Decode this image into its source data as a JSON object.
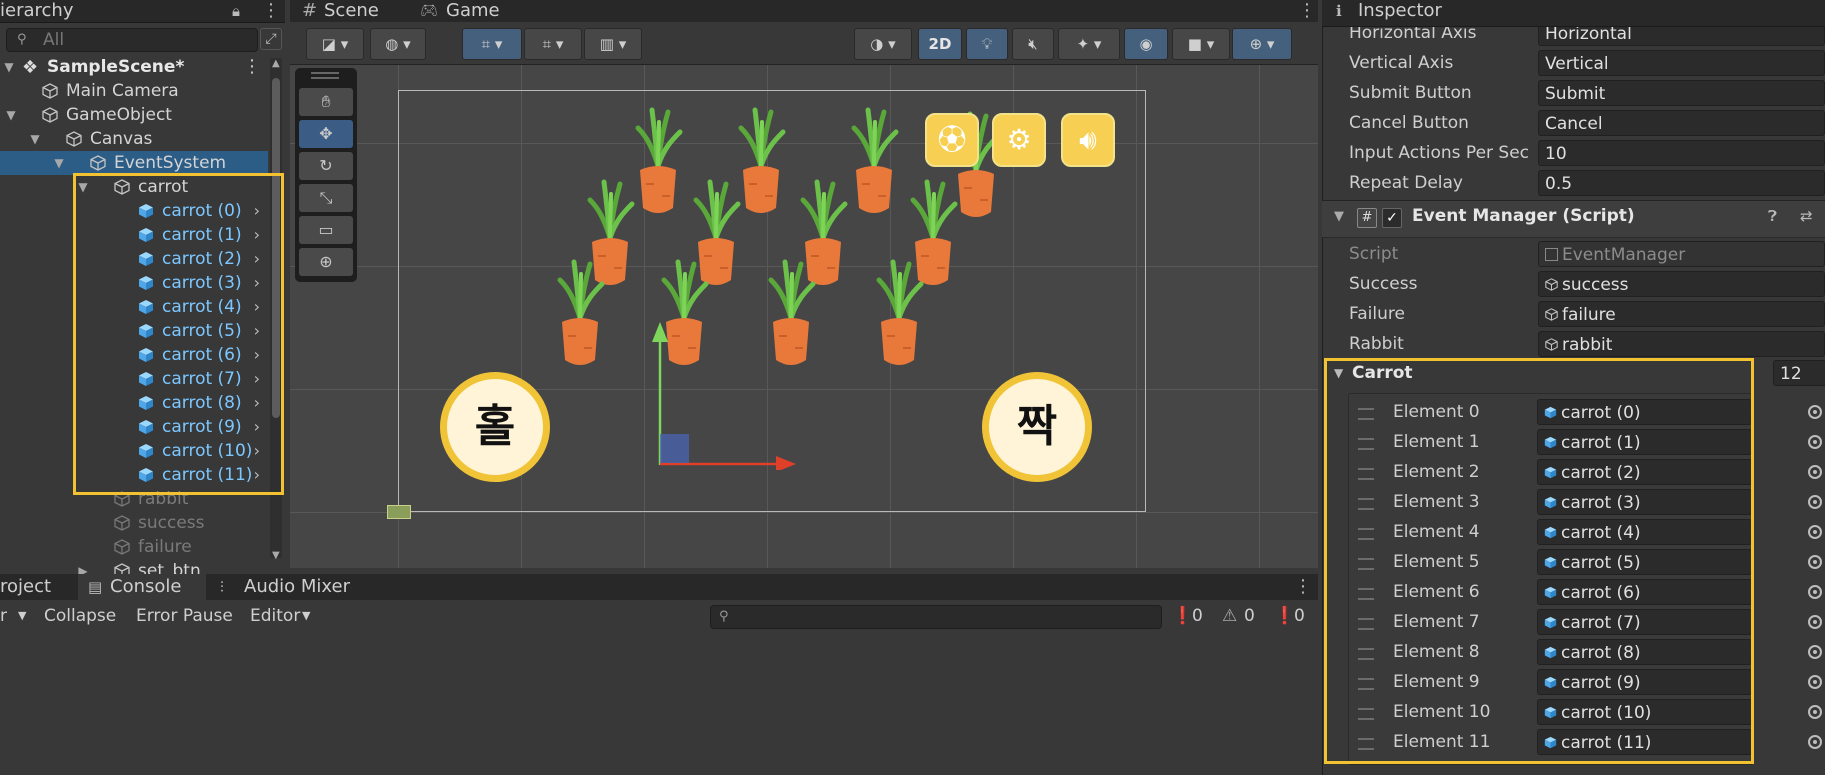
{
  "colors": {
    "highlight": "#f2c230",
    "selection": "#2c5d87",
    "prefab_blue": "#7cc7ff"
  },
  "hierarchy": {
    "tab": "ierarchy",
    "search_placeholder": "All",
    "scene_name": "SampleScene*",
    "items": [
      {
        "label": "Main Camera",
        "style": "normal"
      },
      {
        "label": "GameObject",
        "style": "normal"
      },
      {
        "label": "Canvas",
        "style": "normal"
      },
      {
        "label": "EventSystem",
        "style": "selected"
      },
      {
        "label": "carrot",
        "style": "normal"
      },
      {
        "label": "carrot (0)",
        "style": "prefab"
      },
      {
        "label": "carrot (1)",
        "style": "prefab"
      },
      {
        "label": "carrot (2)",
        "style": "prefab"
      },
      {
        "label": "carrot (3)",
        "style": "prefab"
      },
      {
        "label": "carrot (4)",
        "style": "prefab"
      },
      {
        "label": "carrot (5)",
        "style": "prefab"
      },
      {
        "label": "carrot (6)",
        "style": "prefab"
      },
      {
        "label": "carrot (7)",
        "style": "prefab"
      },
      {
        "label": "carrot (8)",
        "style": "prefab"
      },
      {
        "label": "carrot (9)",
        "style": "prefab"
      },
      {
        "label": "carrot (10)",
        "style": "prefab"
      },
      {
        "label": "carrot (11)",
        "style": "prefab"
      },
      {
        "label": "rabbit",
        "style": "disabled"
      },
      {
        "label": "success",
        "style": "disabled"
      },
      {
        "label": "failure",
        "style": "disabled"
      },
      {
        "label": "set_btn",
        "style": "normal"
      }
    ]
  },
  "scene": {
    "tabs": [
      {
        "label": "Scene"
      },
      {
        "label": "Game"
      }
    ],
    "toolbar": {
      "mode_2d": "2D"
    },
    "coin_left": "홀",
    "coin_right": "짝",
    "top_buttons": [
      {
        "icon": "soccer-ball-icon"
      },
      {
        "icon": "gear-icon"
      },
      {
        "icon": "speaker-icon"
      }
    ]
  },
  "console": {
    "tabs": [
      {
        "label": "roject"
      },
      {
        "label": "Console"
      },
      {
        "label": "Audio Mixer"
      }
    ],
    "toolbar": {
      "clear_suffix": "r",
      "collapse": "Collapse",
      "error_pause": "Error Pause",
      "editor": "Editor"
    },
    "counts": {
      "logs": "0",
      "warnings": "0",
      "errors": "0"
    }
  },
  "inspector": {
    "tab": "Inspector",
    "top_props": [
      {
        "label": "Horizontal Axis",
        "value": "Horizontal"
      },
      {
        "label": "Vertical Axis",
        "value": "Vertical"
      },
      {
        "label": "Submit Button",
        "value": "Submit"
      },
      {
        "label": "Cancel Button",
        "value": "Cancel"
      },
      {
        "label": "Input Actions Per Sec",
        "value": "10"
      },
      {
        "label": "Repeat Delay",
        "value": "0.5"
      }
    ],
    "component": {
      "title": "Event Manager (Script)",
      "script_label": "Script",
      "script_value": "EventManager",
      "refs": [
        {
          "label": "Success",
          "value": "success"
        },
        {
          "label": "Failure",
          "value": "failure"
        },
        {
          "label": "Rabbit",
          "value": "rabbit"
        }
      ],
      "array_label": "Carrot",
      "array_size": "12",
      "elements": [
        {
          "label": "Element 0",
          "value": "carrot (0)"
        },
        {
          "label": "Element 1",
          "value": "carrot (1)"
        },
        {
          "label": "Element 2",
          "value": "carrot (2)"
        },
        {
          "label": "Element 3",
          "value": "carrot (3)"
        },
        {
          "label": "Element 4",
          "value": "carrot (4)"
        },
        {
          "label": "Element 5",
          "value": "carrot (5)"
        },
        {
          "label": "Element 6",
          "value": "carrot (6)"
        },
        {
          "label": "Element 7",
          "value": "carrot (7)"
        },
        {
          "label": "Element 8",
          "value": "carrot (8)"
        },
        {
          "label": "Element 9",
          "value": "carrot (9)"
        },
        {
          "label": "Element 10",
          "value": "carrot (10)"
        },
        {
          "label": "Element 11",
          "value": "carrot (11)"
        }
      ]
    }
  }
}
